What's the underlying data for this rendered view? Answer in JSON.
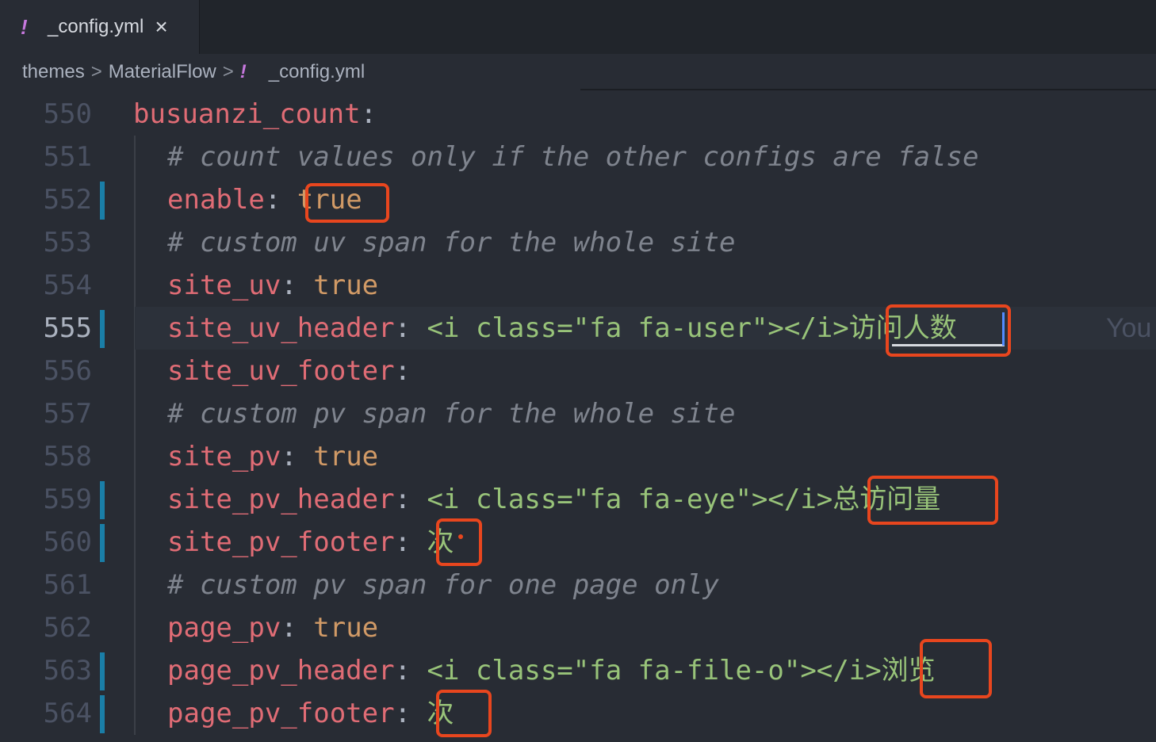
{
  "tab": {
    "icon": "yaml-exclamation-icon",
    "label": "_config.yml",
    "close": "×"
  },
  "breadcrumb": {
    "items": [
      "themes",
      "MaterialFlow"
    ],
    "file": "_config.yml",
    "separator": ">"
  },
  "lines": [
    {
      "num": "550",
      "segs": [
        [
          "k",
          "busuanzi_count"
        ],
        [
          "p",
          ":"
        ]
      ]
    },
    {
      "num": "551",
      "segs": [
        [
          "c",
          "# count values only if the other configs are false"
        ]
      ]
    },
    {
      "num": "552",
      "segs": [
        [
          "k",
          "enable"
        ],
        [
          "p",
          ": "
        ],
        [
          "v",
          "true"
        ]
      ]
    },
    {
      "num": "553",
      "segs": [
        [
          "c",
          "# custom uv span for the whole site"
        ]
      ]
    },
    {
      "num": "554",
      "segs": [
        [
          "k",
          "site_uv"
        ],
        [
          "p",
          ": "
        ],
        [
          "v",
          "true"
        ]
      ]
    },
    {
      "num": "555",
      "segs": [
        [
          "k",
          "site_uv_header"
        ],
        [
          "p",
          ": "
        ],
        [
          "s",
          "<i class=\"fa fa-user\"></i>访问人数"
        ]
      ]
    },
    {
      "num": "556",
      "segs": [
        [
          "k",
          "site_uv_footer"
        ],
        [
          "p",
          ":"
        ]
      ]
    },
    {
      "num": "557",
      "segs": [
        [
          "c",
          "# custom pv span for the whole site"
        ]
      ]
    },
    {
      "num": "558",
      "segs": [
        [
          "k",
          "site_pv"
        ],
        [
          "p",
          ": "
        ],
        [
          "v",
          "true"
        ]
      ]
    },
    {
      "num": "559",
      "segs": [
        [
          "k",
          "site_pv_header"
        ],
        [
          "p",
          ": "
        ],
        [
          "s",
          "<i class=\"fa fa-eye\"></i>总访问量"
        ]
      ]
    },
    {
      "num": "560",
      "segs": [
        [
          "k",
          "site_pv_footer"
        ],
        [
          "p",
          ": "
        ],
        [
          "s",
          "次"
        ]
      ]
    },
    {
      "num": "561",
      "segs": [
        [
          "c",
          "# custom pv span for one page only"
        ]
      ]
    },
    {
      "num": "562",
      "segs": [
        [
          "k",
          "page_pv"
        ],
        [
          "p",
          ": "
        ],
        [
          "v",
          "true"
        ]
      ]
    },
    {
      "num": "563",
      "segs": [
        [
          "k",
          "page_pv_header"
        ],
        [
          "p",
          ": "
        ],
        [
          "s",
          "<i class=\"fa fa-file-o\"></i>浏览"
        ]
      ]
    },
    {
      "num": "564",
      "segs": [
        [
          "k",
          "page_pv_footer"
        ],
        [
          "p",
          ": "
        ],
        [
          "s",
          "次"
        ]
      ]
    }
  ],
  "current_line": "555",
  "modified_lines": [
    "552",
    "555",
    "559",
    "560",
    "563",
    "564"
  ],
  "ghost_text": "You",
  "colors": {
    "highlight_box": "#e8461e",
    "git_modified": "#1a7ea7",
    "key": "#e06c75",
    "string": "#98c379",
    "bool": "#d19a66",
    "comment": "#7f848e"
  }
}
